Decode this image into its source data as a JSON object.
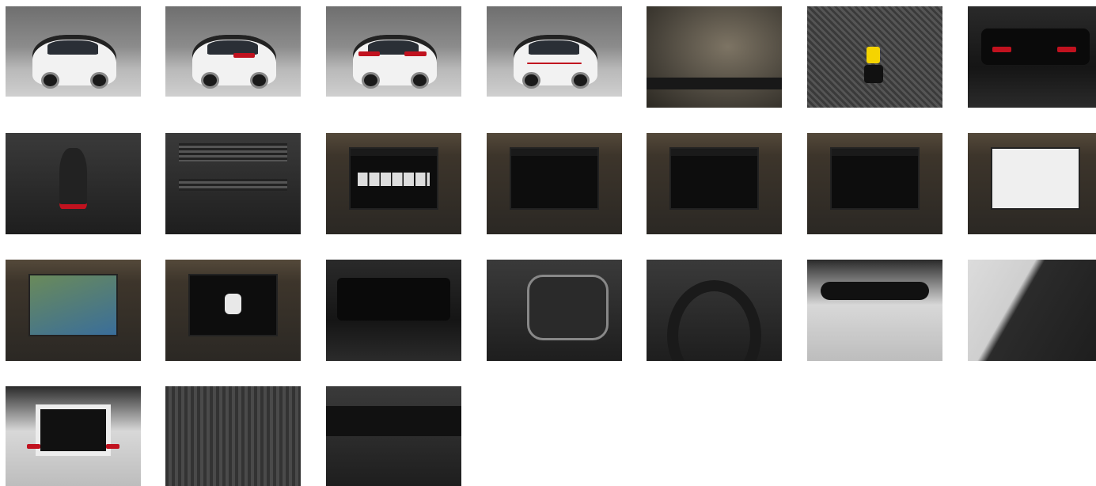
{
  "gallery": {
    "rows": [
      [
        {
          "name": "photo-car-front-left",
          "kind": "exterior"
        },
        {
          "name": "photo-car-rear-left",
          "kind": "exterior"
        },
        {
          "name": "photo-car-rear-right",
          "kind": "exterior"
        },
        {
          "name": "photo-car-front-right",
          "kind": "exterior"
        },
        {
          "name": "photo-vin-windshield",
          "kind": "detail"
        },
        {
          "name": "photo-keys-on-seat",
          "kind": "detail"
        },
        {
          "name": "photo-instrument-cluster-red",
          "kind": "interior"
        }
      ],
      [
        {
          "name": "photo-gear-shifter",
          "kind": "interior"
        },
        {
          "name": "photo-climate-controls",
          "kind": "interior"
        },
        {
          "name": "photo-infotainment-radio",
          "kind": "screen"
        },
        {
          "name": "photo-infotainment-phone",
          "kind": "screen"
        },
        {
          "name": "photo-infotainment-navigation",
          "kind": "screen"
        },
        {
          "name": "photo-infotainment-app-connect",
          "kind": "screen"
        },
        {
          "name": "photo-infotainment-service",
          "kind": "screen"
        }
      ],
      [
        {
          "name": "photo-infotainment-camera",
          "kind": "screen"
        },
        {
          "name": "photo-park-distance-control",
          "kind": "screen"
        },
        {
          "name": "photo-digital-cockpit",
          "kind": "interior"
        },
        {
          "name": "photo-steering-wheel-buttons",
          "kind": "interior"
        },
        {
          "name": "photo-steering-wheel",
          "kind": "interior"
        },
        {
          "name": "photo-rear-view-mirror",
          "kind": "interior"
        },
        {
          "name": "photo-door-panel",
          "kind": "interior"
        }
      ],
      [
        {
          "name": "photo-open-trunk",
          "kind": "exterior"
        },
        {
          "name": "photo-rear-seats",
          "kind": "interior"
        },
        {
          "name": "photo-dashboard-overview",
          "kind": "interior"
        }
      ]
    ]
  }
}
